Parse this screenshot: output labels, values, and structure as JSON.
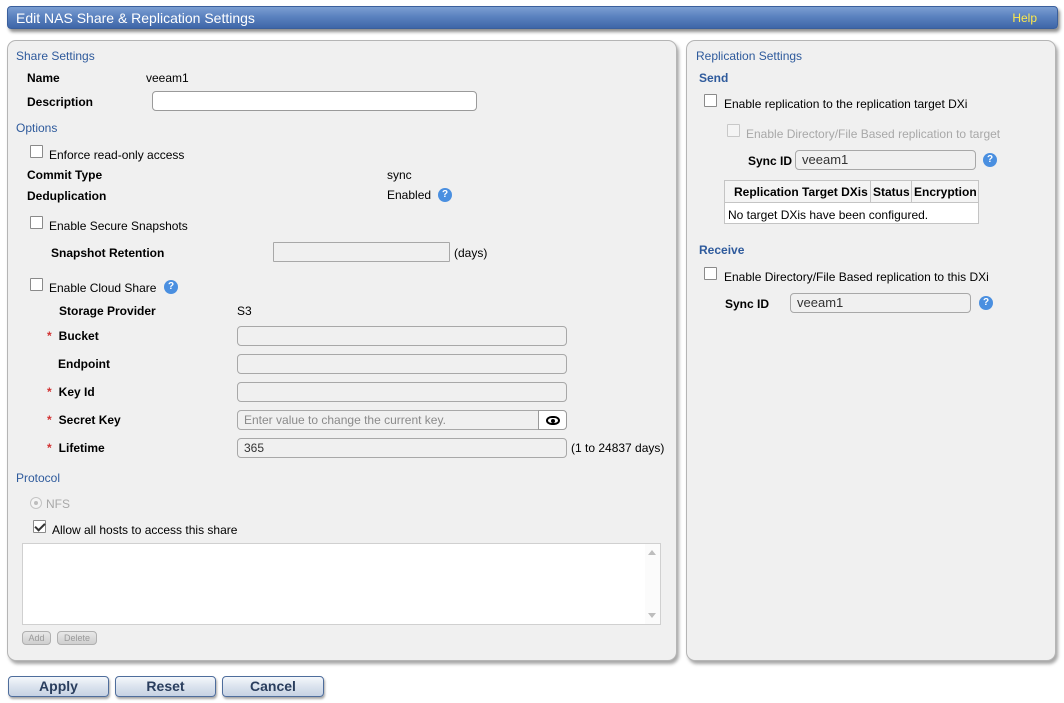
{
  "window": {
    "title": "Edit NAS Share & Replication Settings",
    "help": "Help"
  },
  "share": {
    "section_title": "Share Settings",
    "name_label": "Name",
    "name_value": "veeam1",
    "description_label": "Description",
    "description_value": ""
  },
  "options": {
    "section_title": "Options",
    "readonly_label": "Enforce read-only access",
    "commit_label": "Commit Type",
    "commit_value": "sync",
    "dedup_label": "Deduplication",
    "dedup_value": "Enabled",
    "snapshots_label": "Enable Secure Snapshots",
    "retention_label": "Snapshot Retention",
    "retention_value": "",
    "retention_unit": "(days)",
    "cloud_label": "Enable Cloud Share",
    "provider_label": "Storage Provider",
    "provider_value": "S3",
    "bucket_label": "Bucket",
    "bucket_value": "",
    "endpoint_label": "Endpoint",
    "endpoint_value": "",
    "keyid_label": "Key Id",
    "keyid_value": "",
    "secret_label": "Secret Key",
    "secret_placeholder": "Enter value to change the current key.",
    "lifetime_label": "Lifetime",
    "lifetime_value": "365",
    "lifetime_range": "(1 to 24837 days)",
    "required_mark": "*"
  },
  "protocol": {
    "section_title": "Protocol",
    "nfs_label": "NFS",
    "allow_hosts_label": "Allow all hosts to access this share",
    "add_label": "Add",
    "delete_label": "Delete"
  },
  "replication": {
    "section_title": "Replication Settings",
    "send_title": "Send",
    "enable_target_label": "Enable replication to the replication target DXi",
    "enable_dirfile_target_label": "Enable Directory/File Based replication to target",
    "sync_label": "Sync ID",
    "send_sync_value": "veeam1",
    "table_headers": [
      "Replication Target DXis",
      "Status",
      "Encryption"
    ],
    "table_empty": "No target DXis have been configured.",
    "receive_title": "Receive",
    "enable_dirfile_this_label": "Enable Directory/File Based replication to this DXi",
    "receive_sync_value": "veeam1"
  },
  "footer": {
    "apply": "Apply",
    "reset": "Reset",
    "cancel": "Cancel"
  },
  "colors": {
    "title_bar": "#5b82bf",
    "section": "#2e5a9c",
    "help_icon": "#4a8fe0",
    "required": "#d23232",
    "help_link": "#ffea4a"
  },
  "checkboxes": {
    "readonly": false,
    "snapshots": false,
    "cloud": false,
    "allow_hosts": true,
    "enable_target": false,
    "enable_dirfile_target": false,
    "enable_dirfile_this": false
  },
  "icons": {
    "help": "question-circle-icon",
    "reveal": "eye-icon"
  }
}
